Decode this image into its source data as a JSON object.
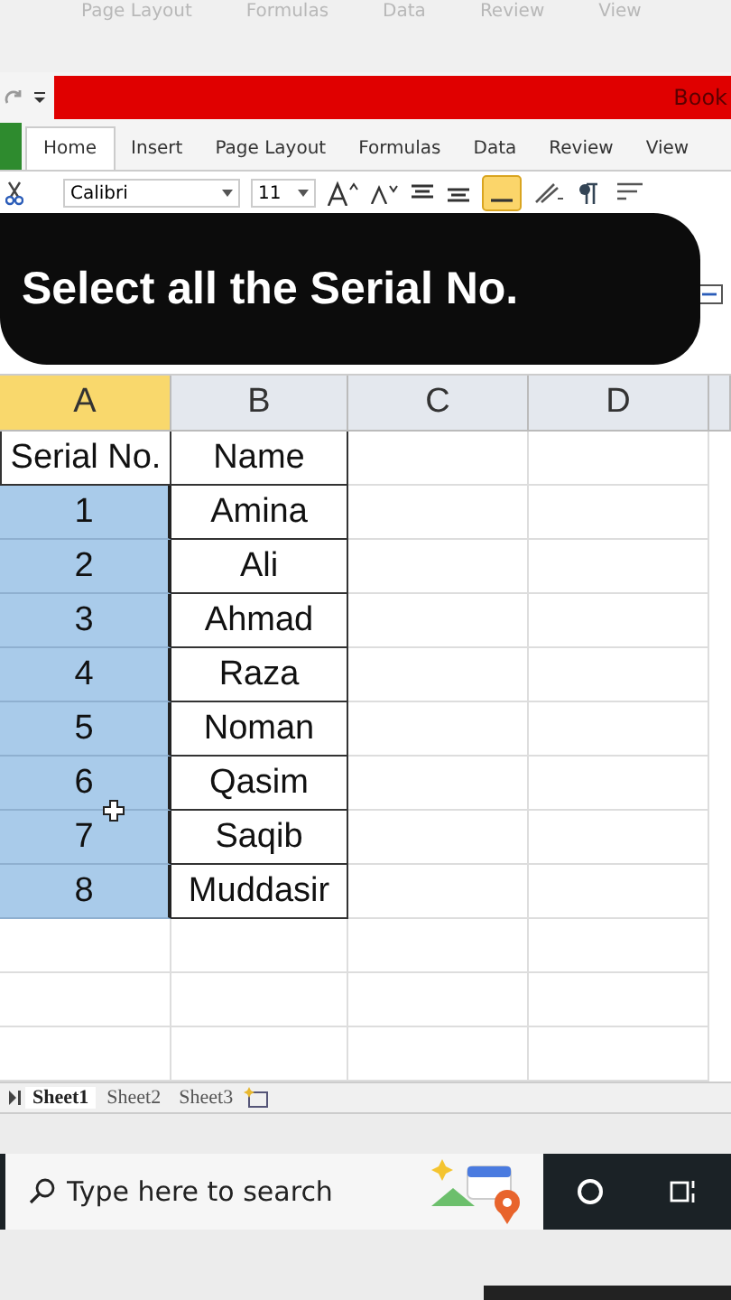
{
  "background_tabs": [
    "Page Layout",
    "Formulas",
    "Data",
    "Review",
    "View"
  ],
  "title_bar": {
    "title": "Book"
  },
  "ribbon_tabs": [
    {
      "label": "Home",
      "selected": true
    },
    {
      "label": "Insert",
      "selected": false
    },
    {
      "label": "Page Layout",
      "selected": false
    },
    {
      "label": "Formulas",
      "selected": false
    },
    {
      "label": "Data",
      "selected": false
    },
    {
      "label": "Review",
      "selected": false
    },
    {
      "label": "View",
      "selected": false
    }
  ],
  "font": {
    "name": "Calibri",
    "size": "11"
  },
  "caption": "Select all the Serial No.",
  "columns": [
    {
      "label": "A",
      "selected": true
    },
    {
      "label": "B",
      "selected": false
    },
    {
      "label": "C",
      "selected": false
    },
    {
      "label": "D",
      "selected": false
    }
  ],
  "rows": [
    {
      "cells": [
        "Serial No.",
        "Name"
      ],
      "selected": false
    },
    {
      "cells": [
        "1",
        "Amina"
      ],
      "selected": true
    },
    {
      "cells": [
        "2",
        "Ali"
      ],
      "selected": true
    },
    {
      "cells": [
        "3",
        "Ahmad"
      ],
      "selected": true
    },
    {
      "cells": [
        "4",
        "Raza"
      ],
      "selected": true
    },
    {
      "cells": [
        "5",
        "Noman"
      ],
      "selected": true
    },
    {
      "cells": [
        "6",
        "Qasim"
      ],
      "selected": true
    },
    {
      "cells": [
        "7",
        "Saqib"
      ],
      "selected": true
    },
    {
      "cells": [
        "8",
        "Muddasir"
      ],
      "selected": true
    }
  ],
  "sheet_tabs": [
    {
      "label": "Sheet1",
      "selected": true
    },
    {
      "label": "Sheet2",
      "selected": false
    },
    {
      "label": "Sheet3",
      "selected": false
    }
  ],
  "taskbar": {
    "search_placeholder": "Type here to search"
  }
}
